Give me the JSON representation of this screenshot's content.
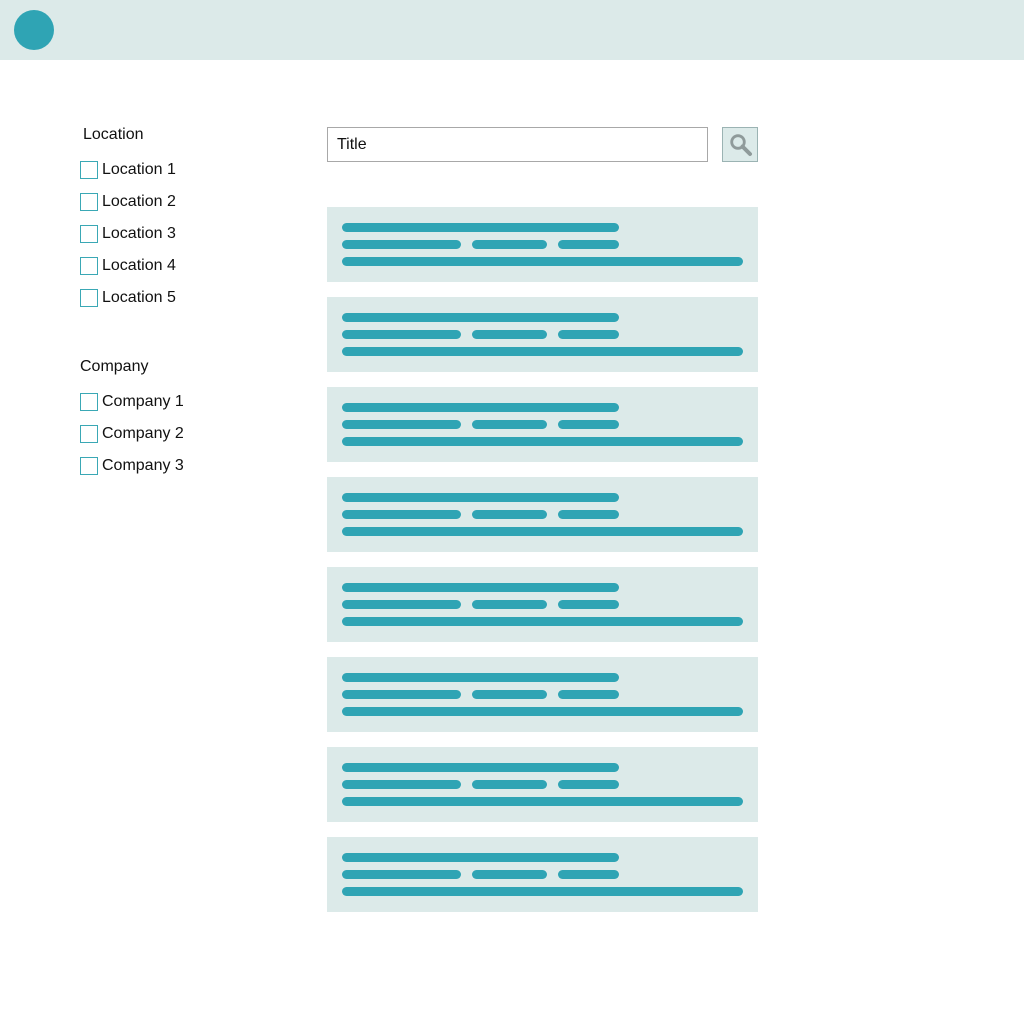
{
  "header": {
    "avatar_icon": "user-avatar-circle",
    "accent_color": "#2fa4b4",
    "background_color": "#dceae9"
  },
  "filters": {
    "location": {
      "title": "Location",
      "options": [
        "Location 1",
        "Location 2",
        "Location 3",
        "Location 4",
        "Location 5"
      ]
    },
    "company": {
      "title": "Company",
      "options": [
        "Company 1",
        "Company 2",
        "Company 3"
      ]
    }
  },
  "search": {
    "placeholder": "Title",
    "value": "",
    "button_icon": "search-icon"
  },
  "results": {
    "count": 8,
    "item_style": "skeleton-placeholder"
  }
}
